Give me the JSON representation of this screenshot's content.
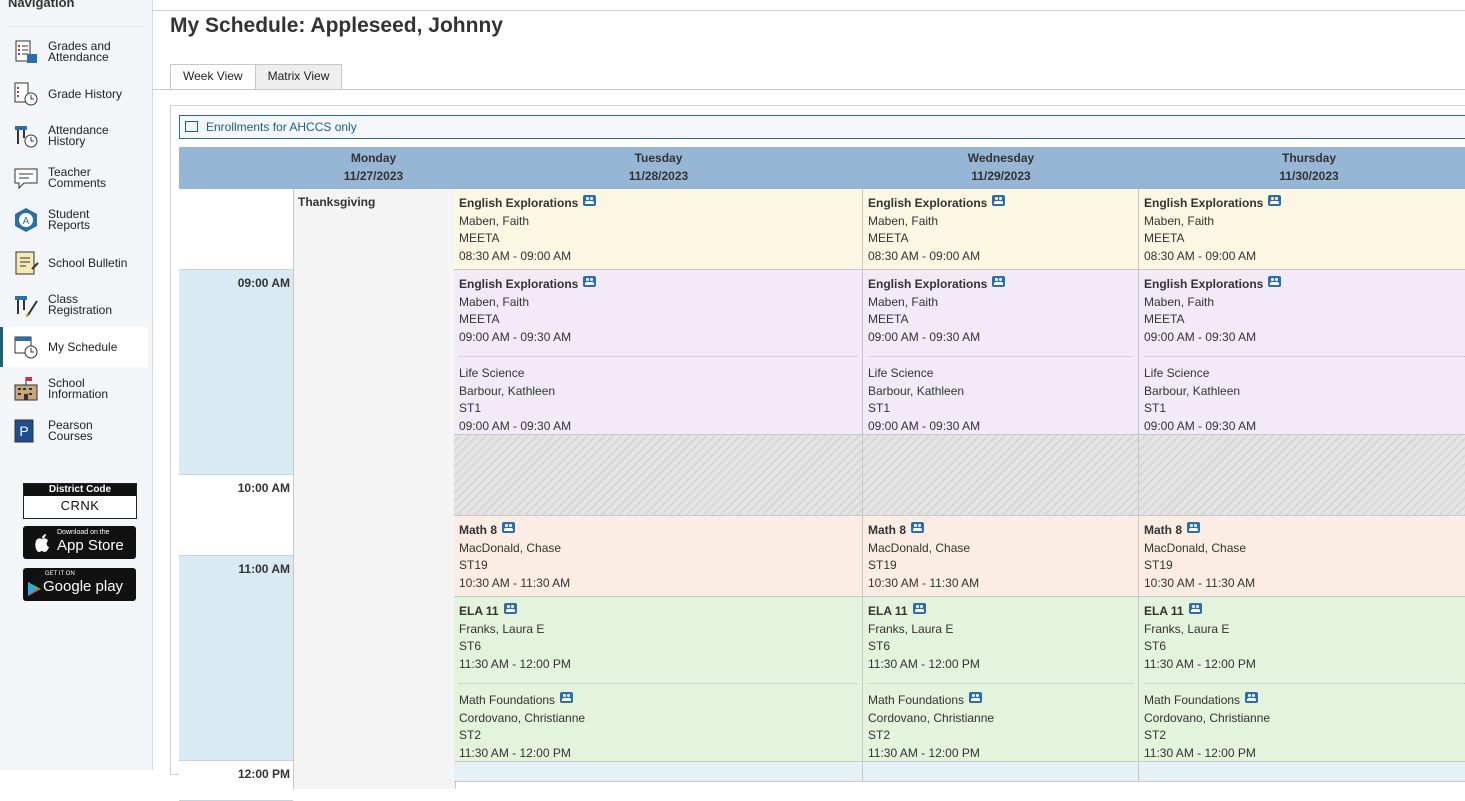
{
  "sidebar": {
    "heading": "Navigation",
    "items": [
      {
        "label": "Grades and\nAttendance",
        "icon": "grades-icon"
      },
      {
        "label": "Grade History",
        "icon": "grade-history-icon"
      },
      {
        "label": "Attendance\nHistory",
        "icon": "attendance-history-icon"
      },
      {
        "label": "Teacher\nComments",
        "icon": "comments-icon"
      },
      {
        "label": "Student\nReports",
        "icon": "reports-icon"
      },
      {
        "label": "School Bulletin",
        "icon": "bulletin-icon"
      },
      {
        "label": "Class\nRegistration",
        "icon": "registration-icon"
      },
      {
        "label": "My Schedule",
        "icon": "schedule-icon"
      },
      {
        "label": "School\nInformation",
        "icon": "school-icon"
      },
      {
        "label": "Pearson\nCourses",
        "icon": "pearson-icon"
      }
    ],
    "district_code_label": "District Code",
    "district_code": "CRNK",
    "app_store_small": "Download on the",
    "app_store_big": "App Store",
    "google_small": "GET IT ON",
    "google_big": "Google play"
  },
  "page": {
    "title": "My Schedule: Appleseed, Johnny",
    "tabs": [
      "Week View",
      "Matrix View"
    ],
    "enrollments": "Enrollments for AHCCS only"
  },
  "schedule": {
    "days": [
      {
        "name": "Monday",
        "date": "11/27/2023"
      },
      {
        "name": "Tuesday",
        "date": "11/28/2023"
      },
      {
        "name": "Wednesday",
        "date": "11/29/2023"
      },
      {
        "name": "Thursday",
        "date": "11/30/2023"
      }
    ],
    "times": [
      "09:00 AM",
      "10:00 AM",
      "11:00 AM",
      "12:00 PM"
    ],
    "monday_note": "Thanksgiving",
    "slots": [
      {
        "color": "yellow",
        "classes": [
          {
            "name": "English Explorations",
            "bold": true,
            "group": true,
            "teacher": "Maben, Faith",
            "room": "MEETA",
            "time": "08:30 AM - 09:00 AM"
          }
        ]
      },
      {
        "color": "purple",
        "classes": [
          {
            "name": "English Explorations",
            "bold": true,
            "group": true,
            "teacher": "Maben, Faith",
            "room": "MEETA",
            "time": "09:00 AM - 09:30 AM"
          },
          {
            "name": "Life Science",
            "bold": false,
            "group": false,
            "teacher": "Barbour, Kathleen",
            "room": "ST1",
            "time": "09:00 AM - 09:30 AM"
          }
        ]
      },
      {
        "color": "hatch",
        "classes": []
      },
      {
        "color": "peach",
        "classes": [
          {
            "name": "Math 8",
            "bold": true,
            "group": true,
            "teacher": "MacDonald, Chase",
            "room": "ST19",
            "time": "10:30 AM - 11:30 AM"
          }
        ]
      },
      {
        "color": "green",
        "classes": [
          {
            "name": "ELA 11",
            "bold": true,
            "group": true,
            "teacher": "Franks, Laura E",
            "room": "ST6",
            "time": "11:30 AM - 12:00 PM"
          },
          {
            "name": "Math Foundations",
            "bold": false,
            "group": true,
            "teacher": "Cordovano, Christianne",
            "room": "ST2",
            "time": "11:30 AM - 12:00 PM"
          }
        ]
      }
    ]
  }
}
